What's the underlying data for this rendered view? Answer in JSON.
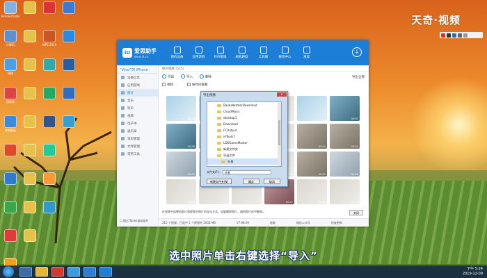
{
  "watermark": "天奇·视频",
  "caption": "选中照片单击右键选择“导入”",
  "desktop": {
    "col1": [
      "Administrator",
      "计算机",
      "网络",
      "回收站",
      "控制面板",
      "",
      "",
      "",
      "",
      "",
      "",
      "",
      "",
      "",
      ""
    ],
    "col2": [
      "",
      "",
      "",
      "",
      "",
      "",
      "",
      "",
      "",
      "",
      "",
      "",
      "",
      ""
    ],
    "col3": [
      "",
      "WPS 2019",
      "",
      "",
      "",
      "",
      "",
      "",
      "",
      "",
      "",
      "",
      ""
    ]
  },
  "taskbar": {
    "time": "下午 5:24",
    "date": "2019-12-09"
  },
  "app": {
    "logo_name": "爱思助手",
    "logo_url": "www.i4.cn",
    "nav": [
      {
        "label": "我的设备",
        "active": false
      },
      {
        "label": "应用游戏",
        "active": false
      },
      {
        "label": "铃声壁纸",
        "active": false
      },
      {
        "label": "刷机越狱",
        "active": false
      },
      {
        "label": "工具箱",
        "active": false
      },
      {
        "label": "教程中心",
        "active": false
      },
      {
        "label": "发现",
        "active": false
      }
    ],
    "device": "“Vincl”的 iPhone",
    "sidebar": [
      {
        "label": "设备信息",
        "active": false
      },
      {
        "label": "应用游戏",
        "active": false
      },
      {
        "label": "照片",
        "active": true
      },
      {
        "label": "音乐",
        "active": false
      },
      {
        "label": "铃声",
        "active": false
      },
      {
        "label": "视频",
        "active": false
      },
      {
        "label": "电子书",
        "active": false
      },
      {
        "label": "通讯录",
        "active": false
      },
      {
        "label": "资料管理",
        "active": false
      },
      {
        "label": "文件管理",
        "active": false
      },
      {
        "label": "常用工具",
        "active": false
      }
    ],
    "breadcrumb": "照片图库 (515)",
    "toolbar": [
      "导出",
      "导入",
      "删除"
    ],
    "right_link": "导出全部",
    "tabs": [
      "视频",
      "按时间查看"
    ],
    "thumb_times": [
      "00:08",
      "00:03",
      "",
      "",
      "",
      "00:07",
      "00:08",
      "",
      "",
      "",
      "00:04",
      "00:09",
      "00:03",
      "",
      "",
      "00:41",
      "00:03",
      "00:08",
      "00:02",
      "",
      "",
      "00:07",
      "00:05",
      "00:08"
    ],
    "hint": "在视频中选择的照片和视频中照片的导出方式，如要删除照片，请到照片库中删除。",
    "close_label": "关闭",
    "status": [
      "215 个视频，已选中 1 个视频共 2032 MB",
      "V7.98.09",
      "修复",
      "微信公众号",
      "检查更新"
    ],
    "itunes_label": "阻止iTunes自动运行"
  },
  "dialog": {
    "title": "导出视频",
    "close": "×",
    "folders": [
      {
        "name": "BaiduNetdiskDownload",
        "selected": false
      },
      {
        "name": "CloudMusic",
        "selected": false
      },
      {
        "name": "desktop1",
        "selected": false
      },
      {
        "name": "Download",
        "selected": false
      },
      {
        "name": "FFOutput",
        "selected": false
      },
      {
        "name": "i4Tools7",
        "selected": false
      },
      {
        "name": "LDSGameMaster",
        "selected": false
      },
      {
        "name": "新建文件夹",
        "selected": false
      },
      {
        "name": "导出文件",
        "selected": false
      },
      {
        "name": "外景",
        "selected": true
      }
    ],
    "file_label": "文件夹(F):",
    "file_value": "外景",
    "new_folder": "新建文件夹(N)",
    "ok": "确定",
    "cancel": "取消"
  }
}
